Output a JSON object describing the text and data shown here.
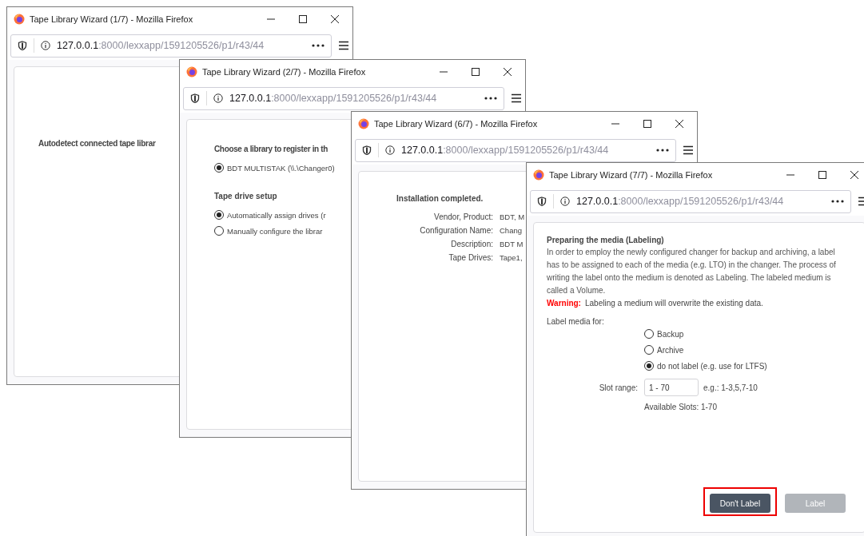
{
  "windows": [
    {
      "kind": "intro",
      "title": "Tape Library Wizard (1/7) - Mozilla Firefox",
      "url": {
        "host": "127.0.0.1",
        "path": ":8000/lexxapp/1591205526/p1/r43/44"
      },
      "content": {
        "heading": "Autodetect connected tape librar"
      }
    },
    {
      "kind": "select",
      "title": "Tape Library Wizard (2/7) - Mozilla Firefox",
      "url": {
        "host": "127.0.0.1",
        "path": ":8000/lexxapp/1591205526/p1/r43/44"
      },
      "content": {
        "heading": "Choose a library to register in th",
        "libraries": [
          {
            "label": "BDT MULTISTAK (\\\\.\\Changer0)",
            "selected": true
          }
        ],
        "section_title": "Tape drive setup",
        "drive_options": [
          {
            "label": "Automatically assign drives (r",
            "selected": true
          },
          {
            "label": "Manually configure the librar",
            "selected": false
          }
        ]
      }
    },
    {
      "kind": "summary",
      "title": "Tape Library Wizard (6/7) - Mozilla Firefox",
      "url": {
        "host": "127.0.0.1",
        "path": ":8000/lexxapp/1591205526/p1/r43/44"
      },
      "content": {
        "heading": "Installation completed.",
        "fields": [
          {
            "label": "Vendor, Product:",
            "value": "BDT, M"
          },
          {
            "label": "Configuration Name:",
            "value": "Chang"
          },
          {
            "label": "Description:",
            "value": "BDT M"
          },
          {
            "label": "Tape Drives:",
            "value": "Tape1,"
          }
        ]
      }
    },
    {
      "kind": "labeling",
      "title": "Tape Library Wizard (7/7) - Mozilla Firefox",
      "url": {
        "host": "127.0.0.1",
        "path": ":8000/lexxapp/1591205526/p1/r43/44"
      },
      "content": {
        "heading": "Preparing the media (Labeling)",
        "description": "In order to employ the newly configured changer for backup and archiving, a label has to be assigned to each of the media (e.g. LTO) in the changer. The process of writing the label onto the medium is denoted as Labeling. The labeled medium is called a Volume.",
        "warning_label": "Warning:",
        "warning_text": "Labeling a medium will overwrite the existing data.",
        "media_label": "Label media for:",
        "media_options": [
          {
            "label": "Backup",
            "selected": false
          },
          {
            "label": "Archive",
            "selected": false
          },
          {
            "label": "do not label (e.g. use for LTFS)",
            "selected": true
          }
        ],
        "slot_label": "Slot range:",
        "slot_value": "1 - 70",
        "slot_hint": "e.g.: 1-3,5,7-10",
        "available": "Available Slots: 1-70",
        "buttons": [
          {
            "label": "Don't Label",
            "kind": "primary",
            "disabled": false,
            "highlighted": true
          },
          {
            "label": "Label",
            "kind": "secondary",
            "disabled": true,
            "highlighted": false
          }
        ]
      }
    }
  ]
}
